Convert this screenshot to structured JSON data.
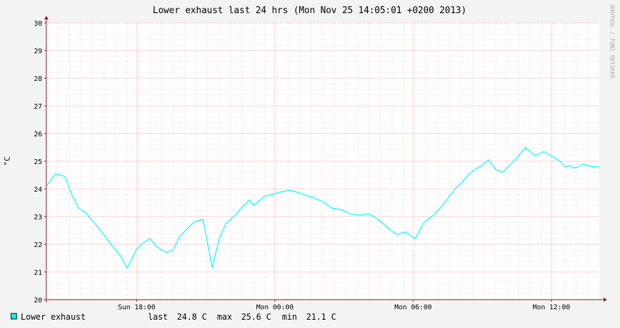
{
  "chart_data": {
    "type": "line",
    "title": "Lower exhaust last 24 hrs (Mon Nov 25 14:05:01 +0200 2013)",
    "ylabel": "°C",
    "ylim": [
      20,
      30
    ],
    "y_ticks": [
      "20",
      "21",
      "22",
      "23",
      "24",
      "25",
      "26",
      "27",
      "28",
      "29",
      "30"
    ],
    "x_ticks": [
      "Sun 18:00",
      "Mon 00:00",
      "Mon 06:00",
      "Mon 12:00"
    ],
    "xlim_hours": [
      -24,
      0
    ],
    "x_tick_hours": [
      -20.08,
      -14.08,
      -8.08,
      -2.08
    ],
    "grid": true,
    "watermark": "RRDTOOL / TOBI OETIKER",
    "colors": {
      "series": "#00ffff",
      "background": "#f3f3f3",
      "canvas": "#ffffff",
      "major_grid": "#ff9a9a",
      "minor_grid": "#e4b8b8",
      "axis": "#8b1a1a"
    },
    "series": [
      {
        "name": "Lower exhaust",
        "x_hours": [
          -24,
          -23.6,
          -23.2,
          -22.9,
          -22.6,
          -22.3,
          -22.0,
          -21.6,
          -21.2,
          -20.8,
          -20.5,
          -20.3,
          -20.1,
          -19.8,
          -19.5,
          -19.2,
          -18.8,
          -18.5,
          -18.2,
          -17.9,
          -17.6,
          -17.2,
          -16.8,
          -16.5,
          -16.2,
          -15.8,
          -15.5,
          -15.3,
          -15.2,
          -15.0,
          -14.8,
          -14.5,
          -14.2,
          -13.8,
          -13.4,
          -13.0,
          -12.7,
          -12.4,
          -12.2,
          -12.0,
          -11.6,
          -11.2,
          -10.8,
          -10.4,
          -10.0,
          -9.6,
          -9.2,
          -8.8,
          -8.4,
          -8.0,
          -7.6,
          -7.2,
          -6.8,
          -6.5,
          -6.2,
          -6.0,
          -5.9,
          -5.7,
          -5.4,
          -5.1,
          -4.8,
          -4.5,
          -4.2,
          -3.9,
          -3.6,
          -3.2,
          -2.8,
          -2.4,
          -2.0,
          -1.7,
          -1.5,
          -1.3,
          -1.1,
          -0.9,
          -0.7,
          -0.5,
          -0.3,
          0
        ],
        "values": [
          24.1,
          24.55,
          24.45,
          23.8,
          23.3,
          23.15,
          22.85,
          22.45,
          22.0,
          21.6,
          21.15,
          21.45,
          21.8,
          22.05,
          22.2,
          21.9,
          21.7,
          21.8,
          22.3,
          22.55,
          22.8,
          22.9,
          21.15,
          22.2,
          22.75,
          23.05,
          23.35,
          23.5,
          23.6,
          23.4,
          23.55,
          23.75,
          23.8,
          23.9,
          23.95,
          23.85,
          23.75,
          23.7,
          23.6,
          23.55,
          23.3,
          23.25,
          23.1,
          23.05,
          23.1,
          22.9,
          22.6,
          22.35,
          22.45,
          22.2,
          22.8,
          23.05,
          23.4,
          23.75,
          24.05,
          24.2,
          24.3,
          24.5,
          24.7,
          24.85,
          25.05,
          24.7,
          24.6,
          24.85,
          25.1,
          25.5,
          25.2,
          25.35,
          25.15,
          25.0,
          24.8,
          24.85,
          24.75,
          24.8,
          24.9,
          24.85,
          24.8,
          24.8
        ]
      }
    ]
  },
  "legend": {
    "label": "Lower exhaust",
    "last_label": "last",
    "last_value": "24.8 C",
    "max_label": "max",
    "max_value": "25.6 C",
    "min_label": "min",
    "min_value": "21.1 C"
  }
}
